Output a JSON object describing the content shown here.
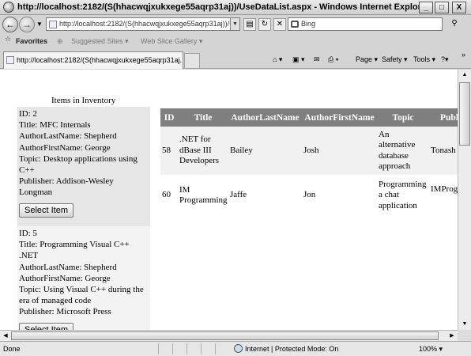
{
  "window": {
    "title": "http://localhost:2182/(S(hhacwqjxukxege55aqrp31aj))/UseDataList.aspx - Windows Internet Explorer",
    "minimize": "_",
    "maximize": "□",
    "close": "X"
  },
  "toolbar": {
    "address_value": "http://localhost:2182/(S(hhacwqjxukxege55aqrp31aj))/Use",
    "search_placeholder": "Bing",
    "refresh_glyph": "↻",
    "stop_glyph": "✕",
    "search_glyph": "⚲"
  },
  "favorites": {
    "label": "Favorites",
    "items": [
      "Suggested Sites ▾",
      "Web Slice Gallery ▾"
    ]
  },
  "tab": {
    "title": "http://localhost:2182/(S(hhacwqjxukxege55aqrp31aj..."
  },
  "commands": [
    "Page ▾",
    "Safety ▾",
    "Tools ▾",
    "»"
  ],
  "page": {
    "inventory_title": "Items in Inventory",
    "select_button": "Select Item",
    "items": [
      {
        "lines": [
          "ID: 2",
          "Title: MFC Internals",
          "AuthorLastName: Shepherd",
          "AuthorFirstName: George",
          "Topic: Desktop applications using C++",
          "Publisher: Addison-Wesley Longman"
        ]
      },
      {
        "lines": [
          "ID: 5",
          "Title: Programming Visual C++ .NET",
          "AuthorLastName: Shepherd",
          "AuthorFirstName: George",
          "Topic: Using Visual C++ during the era of managed code",
          "Publisher: Microsoft Press"
        ]
      }
    ],
    "grid": {
      "headers": [
        "ID",
        "Title",
        "AuthorLastName",
        "AuthorFirstName",
        "Topic",
        "Publ"
      ],
      "rows": [
        [
          "58",
          ".NET for dBase III Developers",
          "Bailey",
          "Josh",
          "An alternative database approach",
          "Tonash"
        ],
        [
          "60",
          "IM Programming",
          "Jaffe",
          "Jon",
          "Programming a chat application",
          "IMProg Press"
        ]
      ]
    }
  },
  "status": {
    "text": "Done",
    "zone": "Internet | Protected Mode: On",
    "zoom": "100% ▾"
  }
}
